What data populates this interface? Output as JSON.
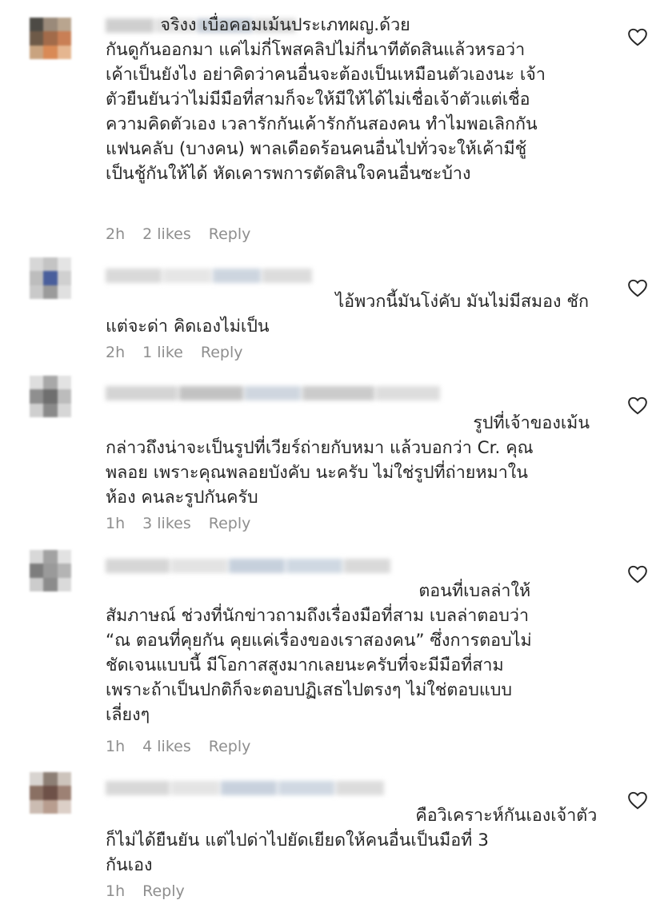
{
  "comments": [
    {
      "text": "          จริงง เบื่อคอมเม้นประเภทผญ.ด้วย\nกันดูกันออกมา แค่ไม่กี่โพสคลิปไม่กี่นาทีตัดสินแล้วหรอว่า\nเค้าเป็นยังไง อย่าคิดว่าคนอื่นจะต้องเป็นเหมือนตัวเองนะ เจ้า\nตัวยืนยันว่าไม่มีมือที่สามก็จะให้มีให้ได้ไม่เชื่อเจ้าตัวแต่เชื่อ\nความคิดตัวเอง เวลารักกันเค้ารักกันสองคน ทำไมพอเลิกกัน\nแฟนคลับ (บางคน) พาลเดือดร้อนคนอื่นไปทั่วจะให้เค้ามีชู้\nเป็นชู้กันให้ได้ หัดเคารพการตัดสินใจคนอื่นซะบ้าง",
      "time": "2h",
      "likes": "2 likes",
      "reply": "Reply"
    },
    {
      "text": "ไอ้พวกนี้มันโง่คับ มันไม่มีสมอง ชัก\nแต่จะด่า คิดเองไม่เป็น",
      "time": "2h",
      "likes": "1 like",
      "reply": "Reply"
    },
    {
      "text": "รูปที่เจ้าของเม้น\nกล่าวถึงน่าจะเป็นรูปที่เวียร์ถ่ายกับหมา แล้วบอกว่า Cr. คุณ\nพลอย เพราะคุณพลอยบังคับ นะครับ ไม่ใช่รูปที่ถ่ายหมาใน\nห้อง คนละรูปกันครับ",
      "time": "1h",
      "likes": "3 likes",
      "reply": "Reply"
    },
    {
      "text": "ตอนที่เบลล่าให้\nสัมภาษณ์ ช่วงที่นักข่าวถามถึงเรื่องมือที่สาม เบลล่าตอบว่า\n“ณ ตอนที่คุยกัน คุยแค่เรื่องของเราสองคน” ซึ่งการตอบไม่\nชัดเจนแบบนี้ มีโอกาสสูงมากเลยนะครับที่จะมีมือที่สาม\nเพราะถ้าเป็นปกติก็จะตอบปฏิเสธไปตรงๆ ไม่ใช่ตอบแบบ\nเลี่ยงๆ",
      "time": "1h",
      "likes": "4 likes",
      "reply": "Reply"
    },
    {
      "text": "คือวิเคราะห์กันเองเจ้าตัว\nก็ไม่ได้ยืนยัน แต่ไปด่าไปยัดเยียดให้คนอื่นเป็นมือที่ 3\nกันเอง",
      "time": "1h",
      "likes": "",
      "reply": "Reply"
    }
  ],
  "colors": {
    "text": "#262626",
    "meta": "#8e8e8e",
    "heart": "#262626"
  },
  "icons": {
    "like": "heart-outline-icon"
  }
}
